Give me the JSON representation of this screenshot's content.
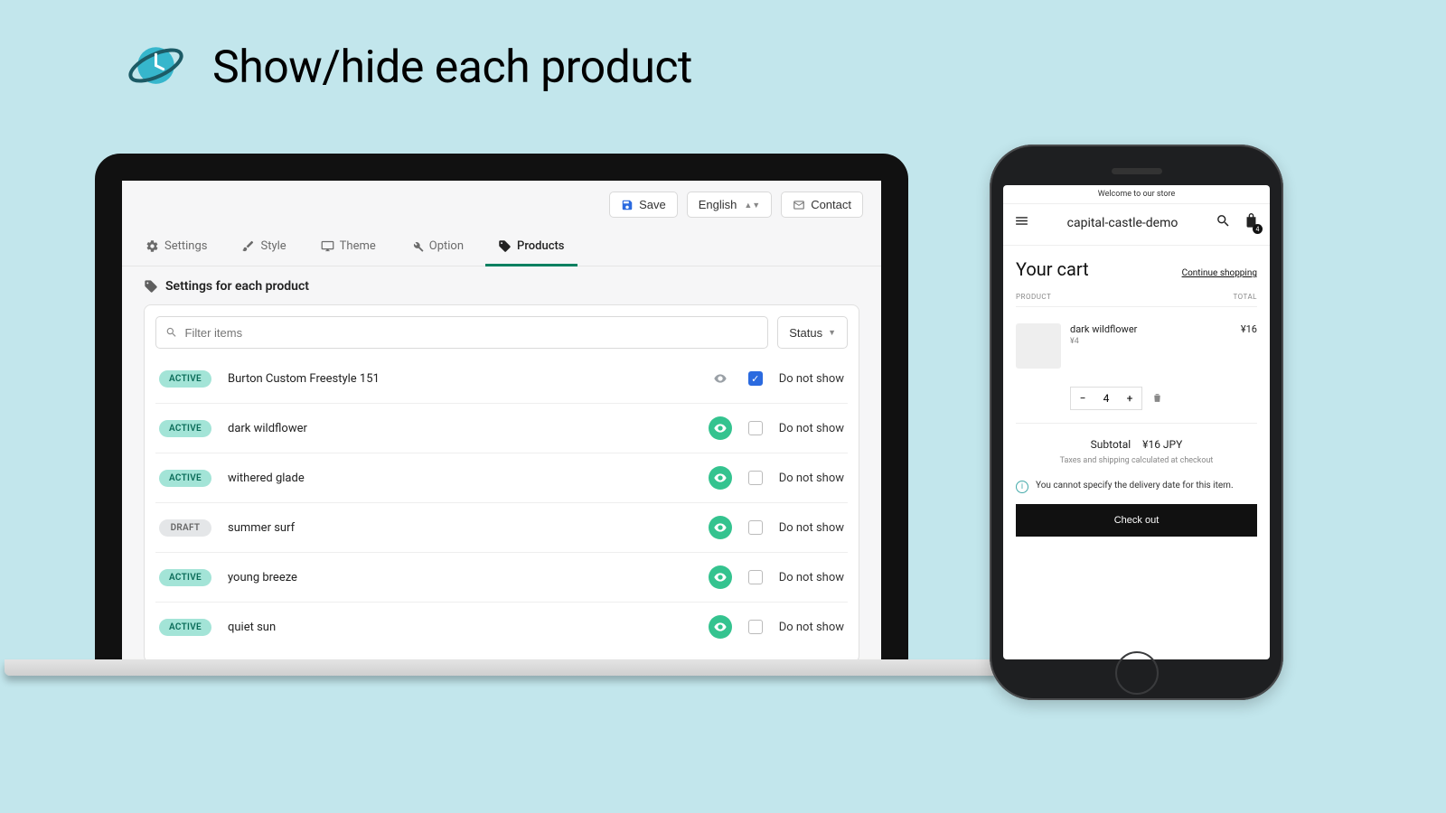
{
  "page_title": "Show/hide each product",
  "admin": {
    "topbar": {
      "save": "Save",
      "language": "English",
      "contact": "Contact"
    },
    "tabs": [
      {
        "label": "Settings"
      },
      {
        "label": "Style"
      },
      {
        "label": "Theme"
      },
      {
        "label": "Option"
      },
      {
        "label": "Products"
      }
    ],
    "section_title": "Settings for each product",
    "search_placeholder": "Filter items",
    "status_label": "Status",
    "do_not_show_label": "Do not show",
    "products": [
      {
        "status": "ACTIVE",
        "status_kind": "active",
        "name": "Burton Custom Freestyle 151",
        "visible": false,
        "do_not_show": true
      },
      {
        "status": "ACTIVE",
        "status_kind": "active",
        "name": "dark wildflower",
        "visible": true,
        "do_not_show": false
      },
      {
        "status": "ACTIVE",
        "status_kind": "active",
        "name": "withered glade",
        "visible": true,
        "do_not_show": false
      },
      {
        "status": "DRAFT",
        "status_kind": "draft",
        "name": "summer surf",
        "visible": true,
        "do_not_show": false
      },
      {
        "status": "ACTIVE",
        "status_kind": "active",
        "name": "young breeze",
        "visible": true,
        "do_not_show": false
      },
      {
        "status": "ACTIVE",
        "status_kind": "active",
        "name": "quiet sun",
        "visible": true,
        "do_not_show": false
      }
    ]
  },
  "store": {
    "announcement": "Welcome to our store",
    "name": "capital-castle-demo",
    "cart_badge": "4",
    "cart": {
      "title": "Your cart",
      "continue": "Continue shopping",
      "col_product": "PRODUCT",
      "col_total": "TOTAL",
      "item": {
        "name": "dark wildflower",
        "unit_price": "¥4",
        "qty": "4",
        "line_total": "¥16"
      },
      "subtotal_label": "Subtotal",
      "subtotal_value": "¥16 JPY",
      "tax_note": "Taxes and shipping calculated at checkout",
      "alert": "You cannot specify the delivery date for this item.",
      "checkout": "Check out"
    }
  }
}
